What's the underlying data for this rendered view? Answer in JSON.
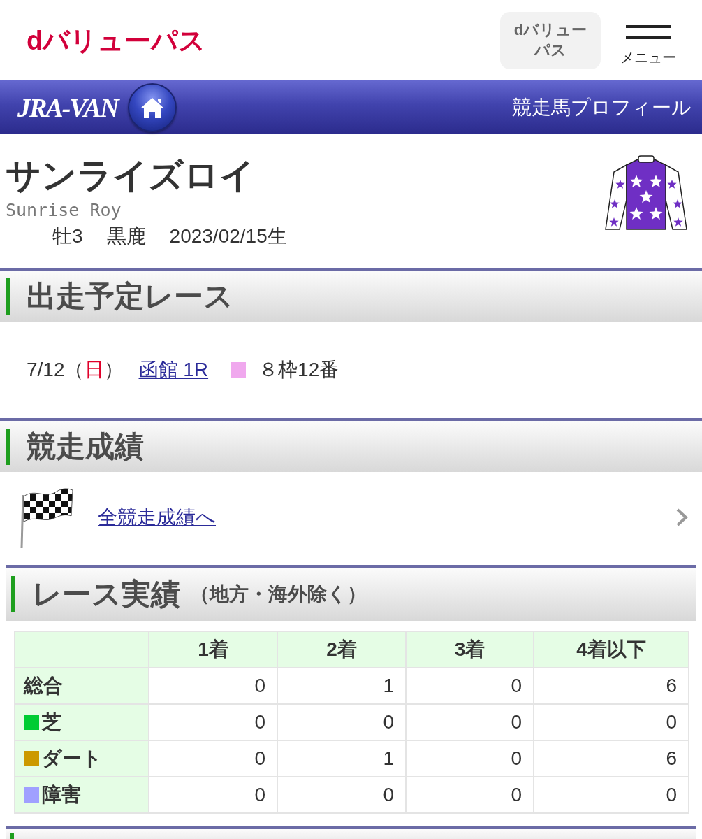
{
  "header": {
    "logo": "dバリューパス",
    "pass_button": "dバリューパス",
    "menu_label": "メニュー"
  },
  "banner": {
    "logo": "JRA-VAN",
    "title": "競走馬プロフィール"
  },
  "horse": {
    "name": "サンライズロイ",
    "name_en": "Sunrise Roy",
    "details": [
      "牡3",
      "黒鹿",
      "2023/02/15生"
    ]
  },
  "upcoming": {
    "title": "出走予定レース",
    "entries": [
      {
        "date": "7/12（",
        "weekday": "日",
        "date_close": "）",
        "race": "函館 1R",
        "color": "#f0a8ee",
        "post": "８枠12番"
      }
    ]
  },
  "results": {
    "title": "競走成績",
    "link": "全競走成績へ"
  },
  "record": {
    "title": "レース実績",
    "note": "（地方・海外除く）",
    "columns": [
      "1着",
      "2着",
      "3着",
      "4着以下"
    ],
    "rows": [
      {
        "label": "総合",
        "values": [
          "0",
          "1",
          "0",
          "6"
        ]
      },
      {
        "label": "芝",
        "color": "#00cc33",
        "values": [
          "0",
          "0",
          "0",
          "0"
        ]
      },
      {
        "label": "ダート",
        "color": "#cc9900",
        "values": [
          "0",
          "1",
          "0",
          "6"
        ]
      },
      {
        "label": "障害",
        "color": "#a0a0ff",
        "values": [
          "0",
          "0",
          "0",
          "0"
        ]
      }
    ]
  }
}
